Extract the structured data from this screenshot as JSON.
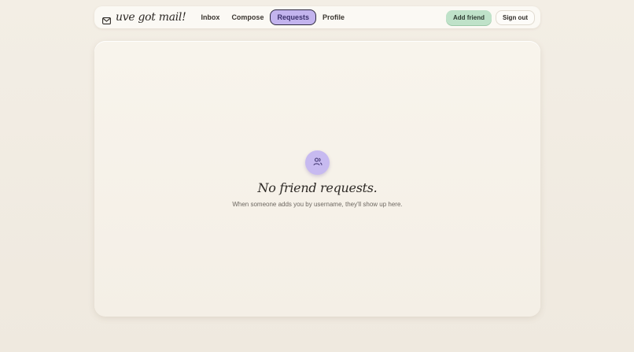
{
  "brand": {
    "icon": "mail-icon",
    "name": "uve got mail!"
  },
  "nav": {
    "links": [
      {
        "label": "Inbox",
        "active": false
      },
      {
        "label": "Compose",
        "active": false
      },
      {
        "label": "Requests",
        "active": true
      },
      {
        "label": "Profile",
        "active": false
      }
    ],
    "add_friend_label": "Add friend",
    "sign_out_label": "Sign out"
  },
  "empty_state": {
    "icon": "users-icon",
    "title": "No friend requests.",
    "subtitle": "When someone adds you by username, they'll show up here."
  },
  "colors": {
    "active_tab": "#c3b4ee",
    "add_friend": "#bfe2c9",
    "badge": "#c7baf0",
    "background": "#f1ece3"
  }
}
